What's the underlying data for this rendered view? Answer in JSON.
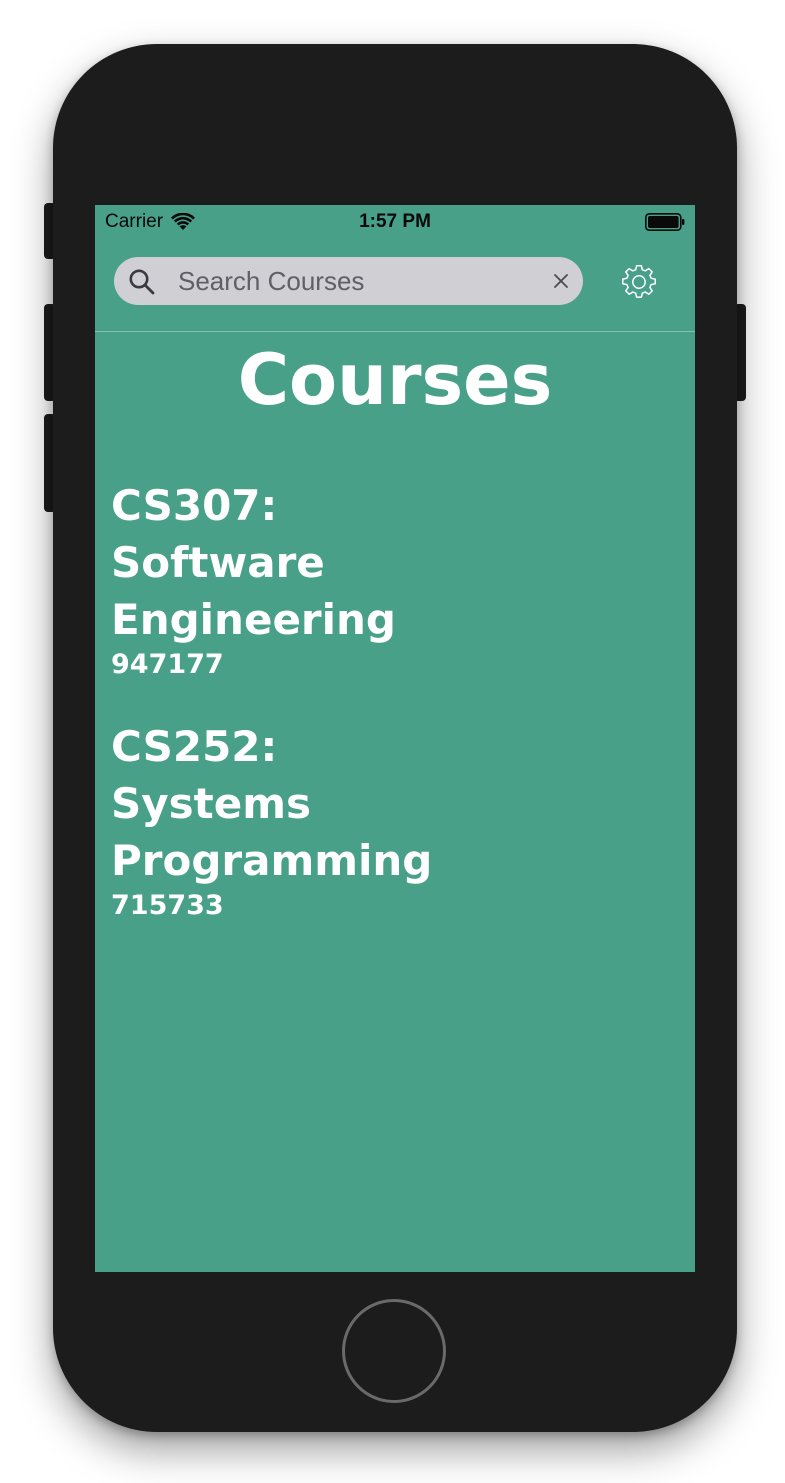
{
  "status_bar": {
    "carrier": "Carrier",
    "time": "1:57 PM",
    "wifi_icon": "wifi-icon",
    "battery_icon": "battery-full-icon"
  },
  "search": {
    "placeholder": "Search Courses",
    "value": "",
    "search_icon": "search-icon",
    "clear_icon": "close-icon"
  },
  "settings": {
    "icon": "gear-icon"
  },
  "page": {
    "title": "Courses"
  },
  "courses": [
    {
      "name": "CS307: Software Engineering",
      "code": "947177"
    },
    {
      "name": "CS252: Systems Programming",
      "code": "715733"
    }
  ],
  "colors": {
    "screen_background": "#47a087",
    "search_background": "#cfcfd4",
    "device_body": "#1c1c1c",
    "text": "#ffffff"
  }
}
